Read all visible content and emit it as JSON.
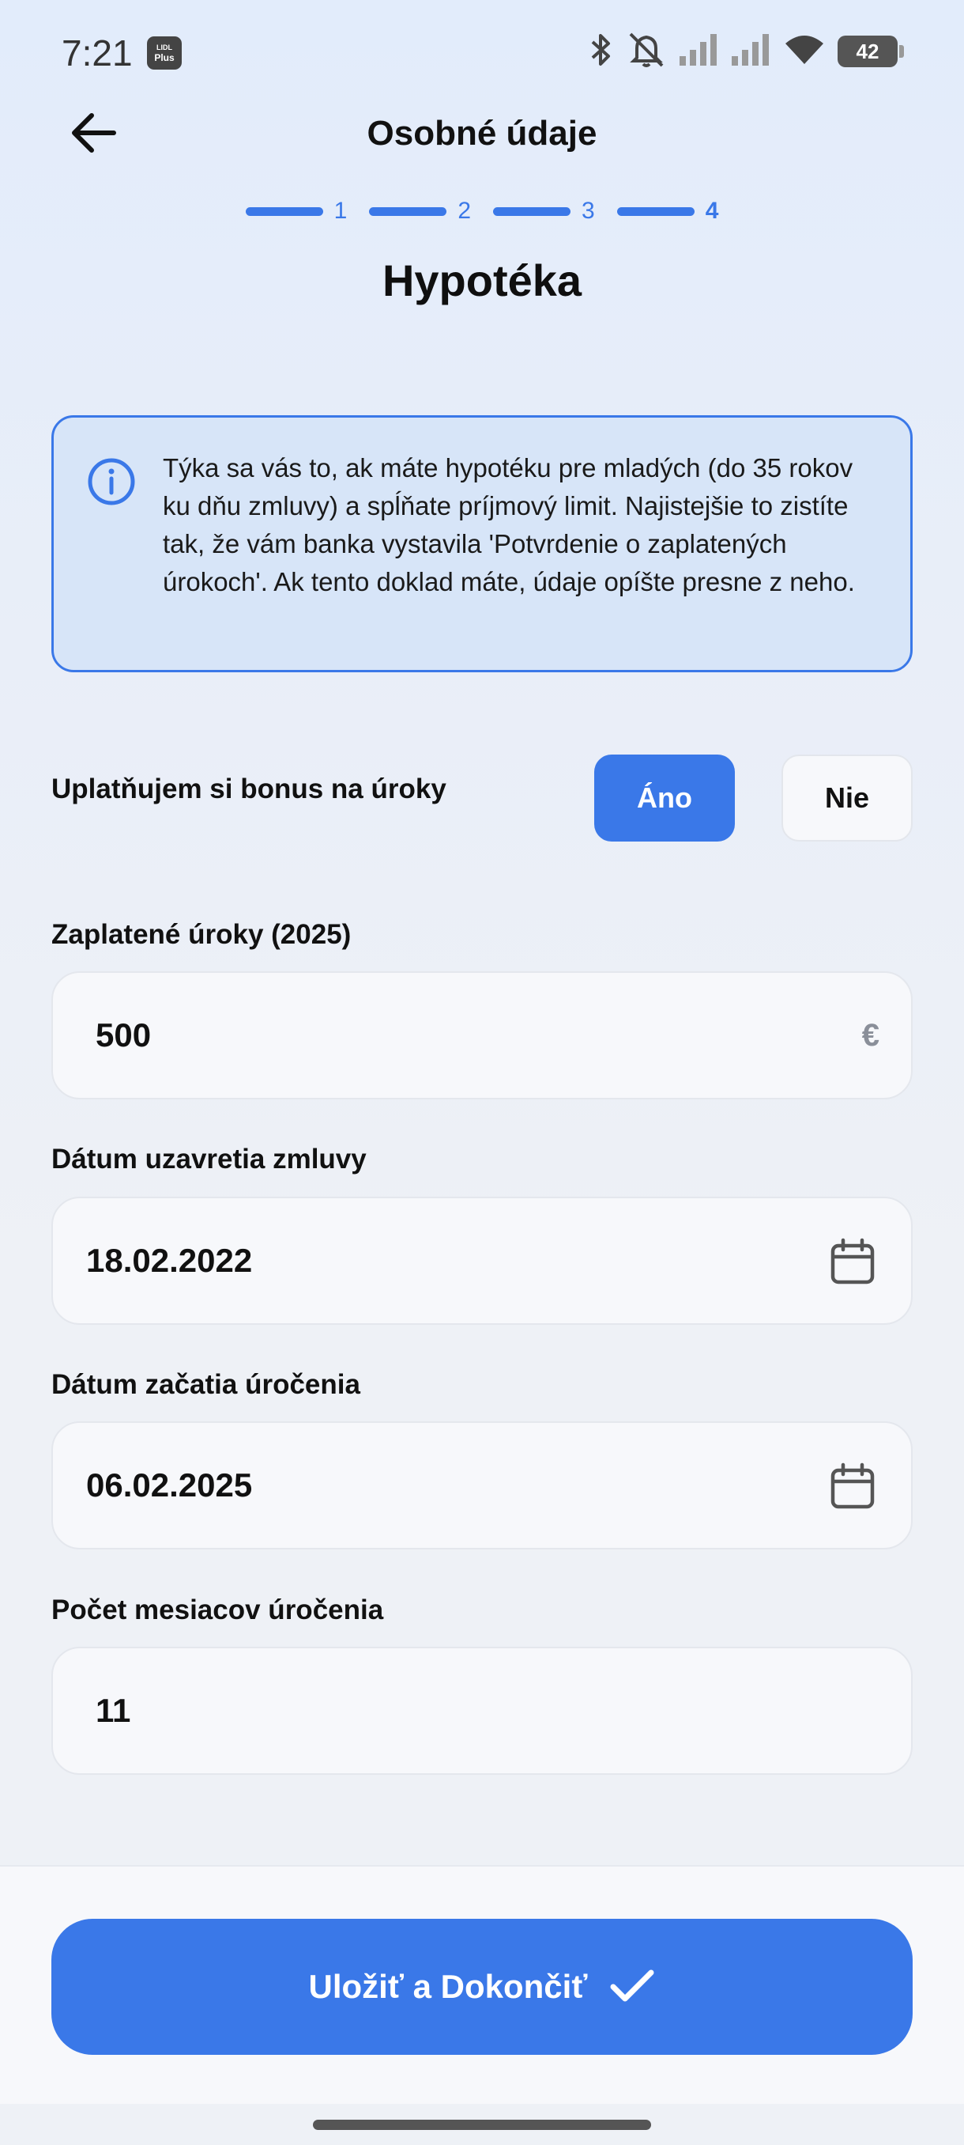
{
  "status_bar": {
    "time": "7:21",
    "app_badge_line1": "LIDL",
    "app_badge_line2": "Plus",
    "battery": "42",
    "icons": [
      "bluetooth-icon",
      "bell-muted-icon",
      "signal-icon",
      "signal-icon",
      "wifi-icon",
      "battery-icon"
    ]
  },
  "header": {
    "title": "Osobné údaje",
    "back_icon": "arrow-left-icon"
  },
  "stepper": {
    "steps": [
      "1",
      "2",
      "3",
      "4"
    ],
    "current_step": "4"
  },
  "section": {
    "title": "Hypotéka"
  },
  "info": {
    "icon": "info-icon",
    "text": "Týka sa vás to, ak máte hypotéku pre mladých (do 35 rokov ku dňu zmluvy) a spĺňate príjmový limit. Najistejšie to zistíte tak, že vám banka vystavila 'Potvrdenie o zaplatených úrokoch'. Ak tento doklad máte, údaje opíšte presne z neho."
  },
  "bonus_toggle": {
    "label": "Uplatňujem si bonus na úroky",
    "yes": "Áno",
    "no": "Nie",
    "selected": "Áno"
  },
  "fields": {
    "interest_paid": {
      "label": "Zaplatené úroky (2025)",
      "value": "500",
      "suffix": "€"
    },
    "contract_date": {
      "label": "Dátum uzavretia zmluvy",
      "value": "18.02.2022",
      "icon": "calendar-icon"
    },
    "interest_start_date": {
      "label": "Dátum začatia úročenia",
      "value": "06.02.2025",
      "icon": "calendar-icon"
    },
    "months_count": {
      "label": "Počet mesiacov úročenia",
      "value": "11"
    }
  },
  "footer": {
    "submit_label": "Uložiť a Dokončiť",
    "submit_icon": "checkmark-icon"
  },
  "colors": {
    "accent": "#3a78e8",
    "info_bg": "#d7e5f8",
    "field_bg": "#f7f8fb"
  }
}
